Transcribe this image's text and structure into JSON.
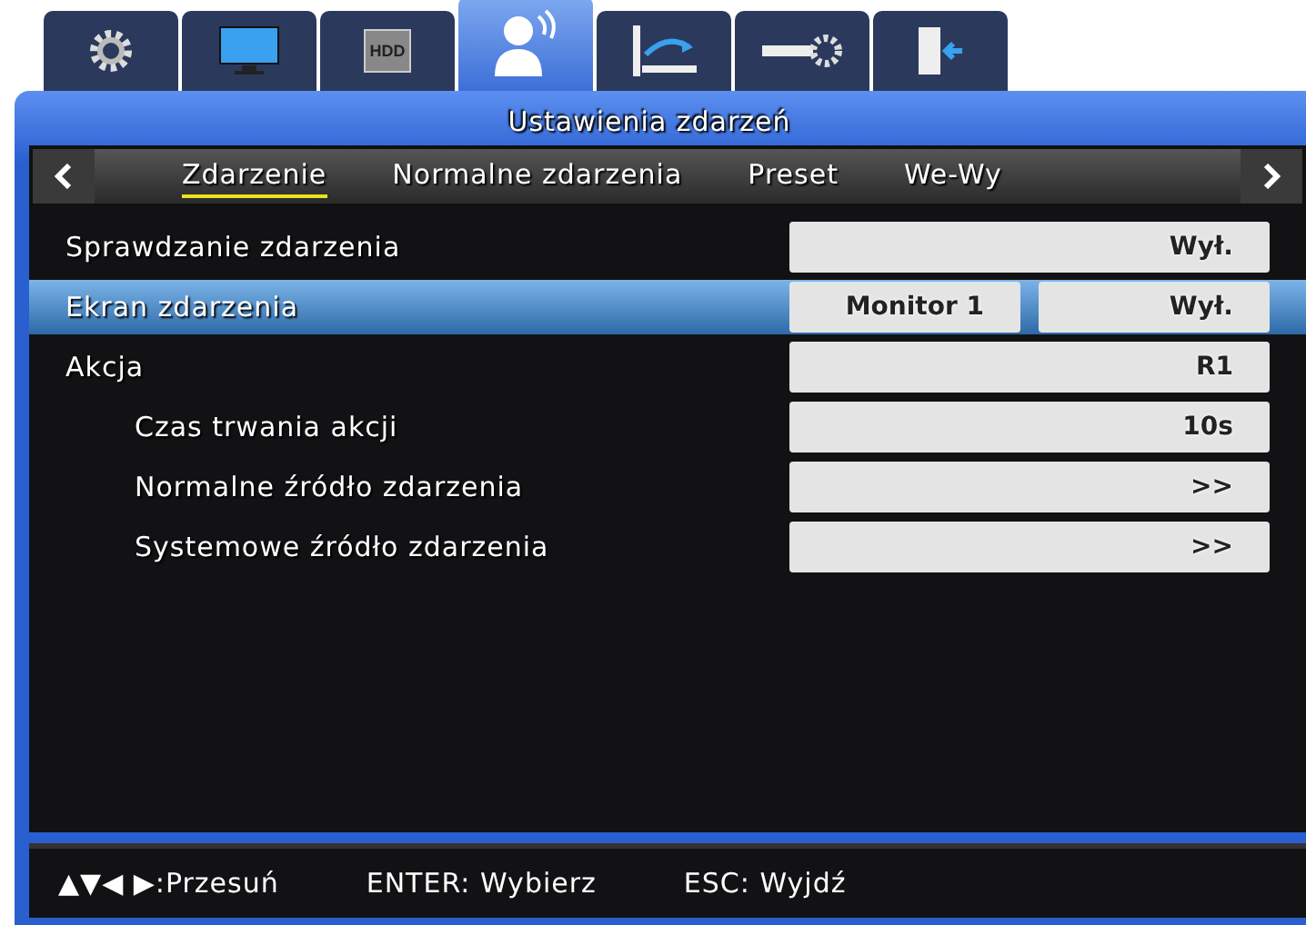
{
  "top_tabs": [
    {
      "kind": "settings",
      "selected": false
    },
    {
      "kind": "display",
      "selected": false
    },
    {
      "kind": "hdd",
      "label": "HDD",
      "selected": false
    },
    {
      "kind": "event",
      "selected": true
    },
    {
      "kind": "network",
      "selected": false
    },
    {
      "kind": "device",
      "selected": false
    },
    {
      "kind": "exit",
      "selected": false
    }
  ],
  "window": {
    "title": "Ustawienia zdarzeń"
  },
  "sub_tabs": [
    {
      "label": "Zdarzenie",
      "selected": true
    },
    {
      "label": "Normalne zdarzenia",
      "selected": false
    },
    {
      "label": "Preset",
      "selected": false
    },
    {
      "label": "We-Wy",
      "selected": false
    }
  ],
  "settings": [
    {
      "label": "Sprawdzanie zdarzenia",
      "values": [
        "Wył."
      ],
      "selected": false
    },
    {
      "label": "Ekran zdarzenia",
      "values": [
        "Monitor 1",
        "Wył."
      ],
      "selected": true
    },
    {
      "label": "Akcja",
      "values": [
        "R1"
      ],
      "selected": false,
      "children": [
        {
          "label": "Czas trwania akcji",
          "values": [
            "10s"
          ],
          "selected": false
        },
        {
          "label": "Normalne źródło zdarzenia",
          "values": [
            ">>"
          ],
          "selected": false
        },
        {
          "label": "Systemowe źródło zdarzenia",
          "values": [
            ">>"
          ],
          "selected": false
        }
      ]
    }
  ],
  "footer": [
    {
      "keys": "▲▼◀ ▶",
      "action": ":Przesuń"
    },
    {
      "keys": "ENTER",
      "action": ": Wybierz"
    },
    {
      "keys": "ESC",
      "action": ": Wyjdź"
    }
  ]
}
